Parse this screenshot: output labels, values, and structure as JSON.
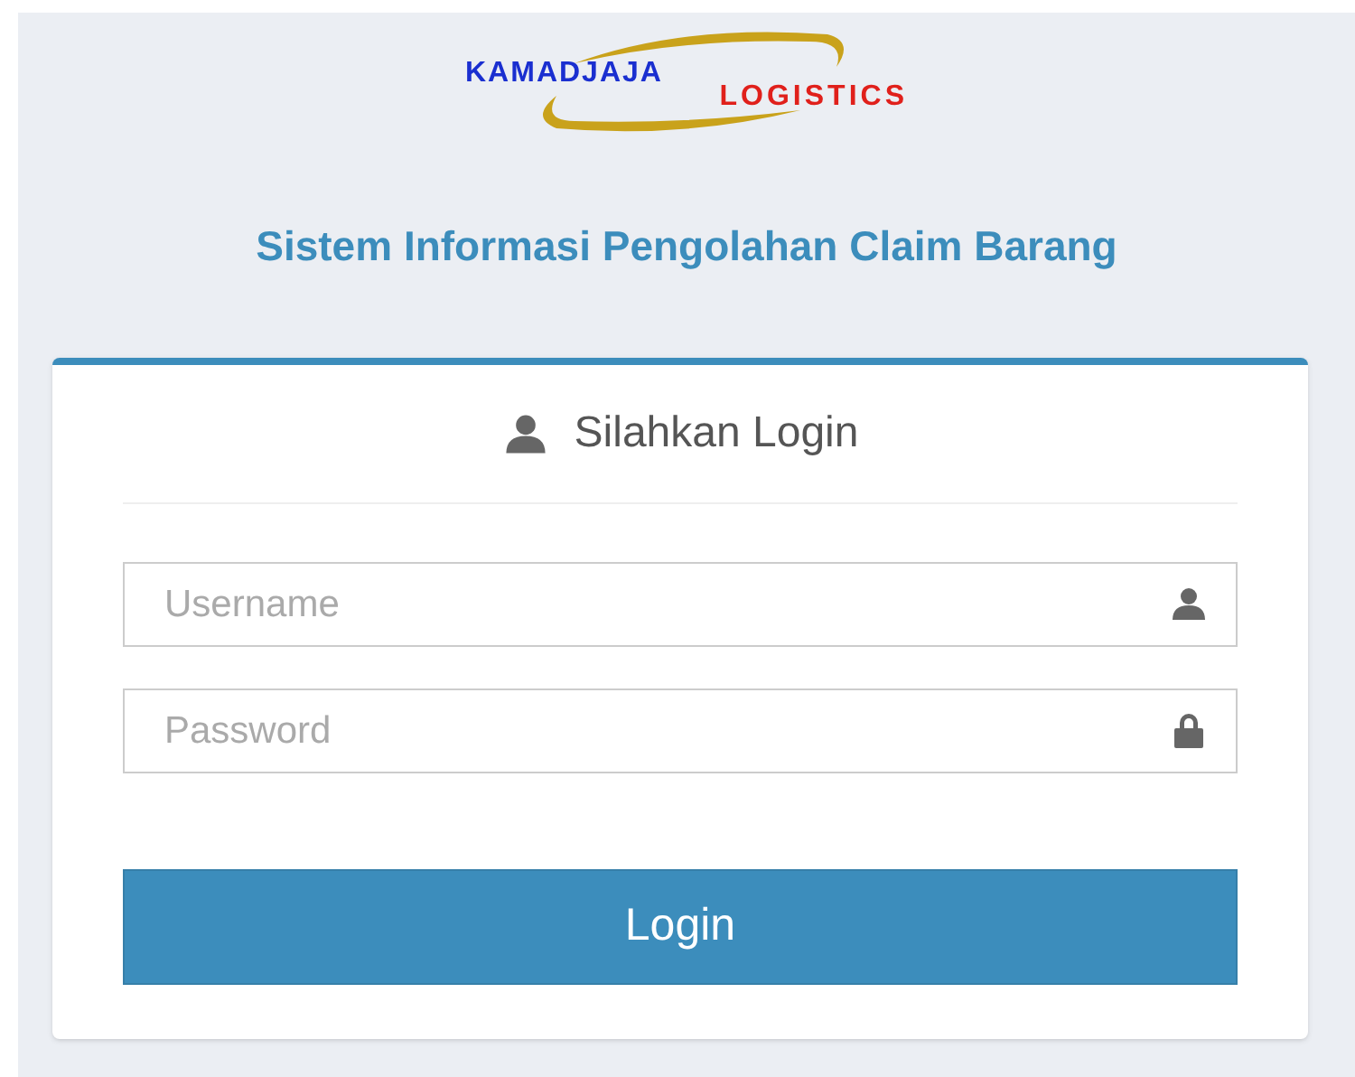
{
  "logo": {
    "top": "KAMADJAJA",
    "bottom": "LOGISTICS"
  },
  "title": "Sistem Informasi Pengolahan Claim Barang",
  "login_box": {
    "heading": "Silahkan Login",
    "fields": [
      {
        "kind": "user",
        "placeholder": "Username"
      },
      {
        "kind": "lock",
        "placeholder": "Password"
      }
    ],
    "button": "Login"
  }
}
